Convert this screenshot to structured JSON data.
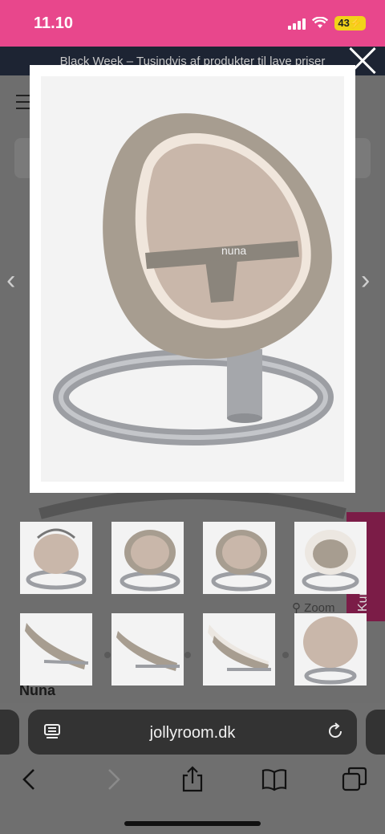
{
  "status": {
    "time": "11.10",
    "battery": "43"
  },
  "site": {
    "promo_text": "Black Week – Tusindvis af produkter til lave priser",
    "zoom_label": "Zoom",
    "brand": "Nuna",
    "kundeservice": "Kundeservice"
  },
  "modal": {
    "image_brand_mark": "nuna",
    "thumbnails": [
      "thumb-1",
      "thumb-2",
      "thumb-3",
      "thumb-4",
      "thumb-5",
      "thumb-6",
      "thumb-7",
      "thumb-8"
    ]
  },
  "browser": {
    "url": "jollyroom.dk"
  },
  "colors": {
    "status_bar": "#e8478c",
    "fabric": "#c9b7aa",
    "shell": "#a79d90",
    "frame": "#9c9ea3",
    "kundeservice": "#7b1c47"
  }
}
